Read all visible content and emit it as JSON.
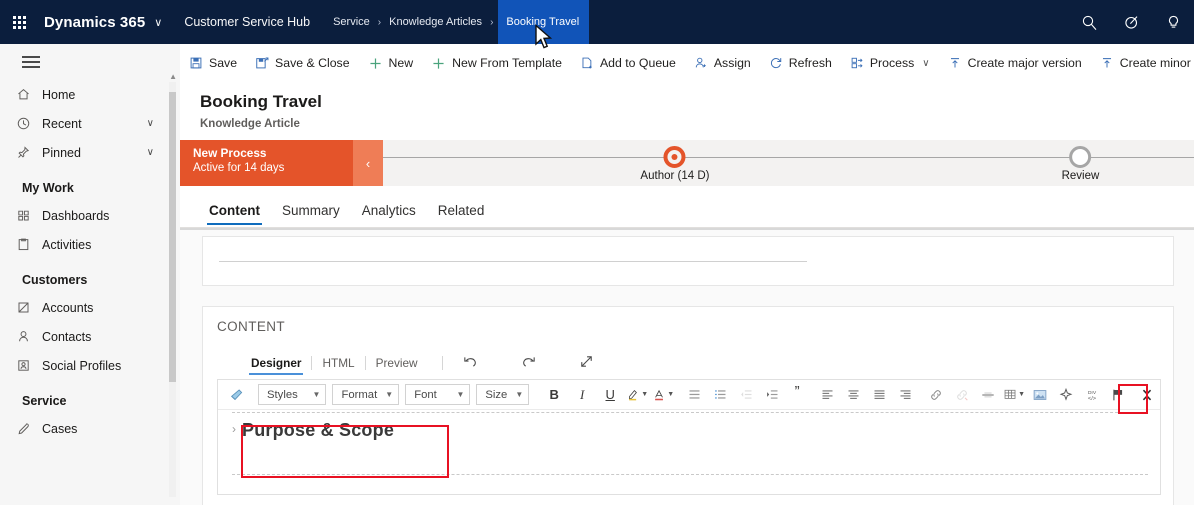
{
  "topnav": {
    "waffle_label": "App launcher",
    "brand": "Dynamics 365",
    "brand_chevron": "∨",
    "app_name": "Customer Service Hub",
    "breadcrumbs": [
      {
        "label": "Service",
        "active": false
      },
      {
        "label": "Knowledge Articles",
        "active": false
      },
      {
        "label": "Booking Travel",
        "active": true
      }
    ],
    "separator": "›",
    "icons": [
      {
        "name": "search-icon",
        "title": "Search"
      },
      {
        "name": "filter-icon",
        "title": "Filter"
      },
      {
        "name": "lightbulb-icon",
        "title": "Assistant"
      }
    ],
    "active_crumb_bg": "#1154b8",
    "bar_bg": "#0b1e3d"
  },
  "sidebar": {
    "hamburger_label": "Expand navigation",
    "items": [
      {
        "label": "Home",
        "icon": "home-icon",
        "chevron": ""
      },
      {
        "label": "Recent",
        "icon": "clock-icon",
        "chevron": "∨"
      },
      {
        "label": "Pinned",
        "icon": "pin-icon",
        "chevron": "∨"
      }
    ],
    "groups": [
      {
        "title": "My Work",
        "items": [
          {
            "label": "Dashboards",
            "icon": "dashboard-icon"
          },
          {
            "label": "Activities",
            "icon": "activities-icon"
          }
        ]
      },
      {
        "title": "Customers",
        "items": [
          {
            "label": "Accounts",
            "icon": "account-icon"
          },
          {
            "label": "Contacts",
            "icon": "contact-icon"
          },
          {
            "label": "Social Profiles",
            "icon": "social-profile-icon"
          }
        ]
      },
      {
        "title": "Service",
        "items": [
          {
            "label": "Cases",
            "icon": "case-icon"
          }
        ]
      }
    ]
  },
  "commandbar": {
    "commands": [
      {
        "label": "Save",
        "icon": "save-icon",
        "chevron": ""
      },
      {
        "label": "Save & Close",
        "icon": "save-close-icon",
        "chevron": ""
      },
      {
        "label": "New",
        "icon": "plus-icon",
        "chevron": ""
      },
      {
        "label": "New From Template",
        "icon": "plus-icon",
        "chevron": ""
      },
      {
        "label": "Add to Queue",
        "icon": "add-queue-icon",
        "chevron": ""
      },
      {
        "label": "Assign",
        "icon": "assign-icon",
        "chevron": ""
      },
      {
        "label": "Refresh",
        "icon": "refresh-icon",
        "chevron": ""
      },
      {
        "label": "Process",
        "icon": "process-icon",
        "chevron": "∨"
      },
      {
        "label": "Create major version",
        "icon": "major-version-icon",
        "chevron": ""
      },
      {
        "label": "Create minor v",
        "icon": "minor-version-icon",
        "chevron": ""
      }
    ]
  },
  "record": {
    "title": "Booking Travel",
    "entity": "Knowledge Article"
  },
  "process": {
    "name": "New Process",
    "status": "Active for 14 days",
    "collapse_glyph": "‹",
    "accent": "#e4542a",
    "stages": [
      {
        "label": "Author",
        "duration": "(14 D)",
        "state": "active"
      },
      {
        "label": "Review",
        "duration": "",
        "state": "idle"
      }
    ]
  },
  "form_tabs": [
    {
      "label": "Content",
      "selected": true
    },
    {
      "label": "Summary",
      "selected": false
    },
    {
      "label": "Analytics",
      "selected": false
    },
    {
      "label": "Related",
      "selected": false
    }
  ],
  "content_section": {
    "label": "CONTENT",
    "editor_tabs": [
      {
        "label": "Designer",
        "selected": true
      },
      {
        "label": "HTML",
        "selected": false
      },
      {
        "label": "Preview",
        "selected": false
      }
    ],
    "editor_actions": [
      {
        "name": "undo-icon",
        "title": "Undo"
      },
      {
        "name": "redo-icon",
        "title": "Redo"
      },
      {
        "name": "expand-icon",
        "title": "Full screen"
      }
    ],
    "toolbar": {
      "format_painter": {
        "name": "format-painter-icon",
        "title": "Format painter"
      },
      "dropdowns": [
        {
          "label": "Styles",
          "width": 80
        },
        {
          "label": "Format",
          "width": 78
        },
        {
          "label": "Font",
          "width": 76
        },
        {
          "label": "Size",
          "width": 52
        }
      ],
      "buttons": [
        {
          "name": "bold-icon",
          "glyph": "B",
          "type": "text",
          "bold": true,
          "dim": false
        },
        {
          "name": "italic-icon",
          "glyph": "I",
          "type": "text",
          "italic": true,
          "dim": false
        },
        {
          "name": "underline-icon",
          "glyph": "U",
          "type": "text",
          "underline": true,
          "dim": false
        },
        {
          "name": "highlight-color-icon",
          "type": "svg",
          "caret": true,
          "dim": false
        },
        {
          "name": "font-color-icon",
          "type": "svg",
          "caret": true,
          "dim": false
        },
        {
          "name": "bulleted-list-icon",
          "type": "svg",
          "dim": false
        },
        {
          "name": "numbered-list-icon",
          "type": "svg",
          "dim": false
        },
        {
          "name": "decrease-indent-icon",
          "type": "svg",
          "dim": true
        },
        {
          "name": "increase-indent-icon",
          "type": "svg",
          "dim": false
        },
        {
          "name": "blockquote-icon",
          "glyph": "”",
          "type": "text",
          "dim": false
        },
        {
          "name": "align-left-icon",
          "type": "svg",
          "dim": false
        },
        {
          "name": "align-center-icon",
          "type": "svg",
          "dim": false
        },
        {
          "name": "align-justify-icon",
          "type": "svg",
          "dim": false
        },
        {
          "name": "align-right-icon",
          "type": "svg",
          "dim": false
        },
        {
          "name": "insert-link-icon",
          "type": "svg",
          "dim": false
        },
        {
          "name": "remove-link-icon",
          "type": "svg",
          "dim": true
        },
        {
          "name": "horizontal-rule-icon",
          "type": "svg",
          "dim": false
        },
        {
          "name": "insert-table-icon",
          "type": "svg",
          "caret": true,
          "dim": false
        },
        {
          "name": "insert-image-icon",
          "type": "svg",
          "dim": false
        },
        {
          "name": "smart-assist-icon",
          "type": "svg",
          "dim": false
        },
        {
          "name": "source-code-icon",
          "type": "svg",
          "dim": false
        },
        {
          "name": "flag-icon",
          "type": "svg",
          "dim": false
        },
        {
          "name": "collapse-toolbar-icon",
          "type": "svg",
          "dim": false,
          "highlighted": true
        }
      ]
    },
    "body": {
      "heading": "Purpose & Scope",
      "heading_chevron": "›"
    }
  },
  "annotations": {
    "color": "#e81123",
    "boxes": [
      {
        "name": "collapse-toolbar-highlight"
      },
      {
        "name": "heading-highlight"
      }
    ]
  }
}
